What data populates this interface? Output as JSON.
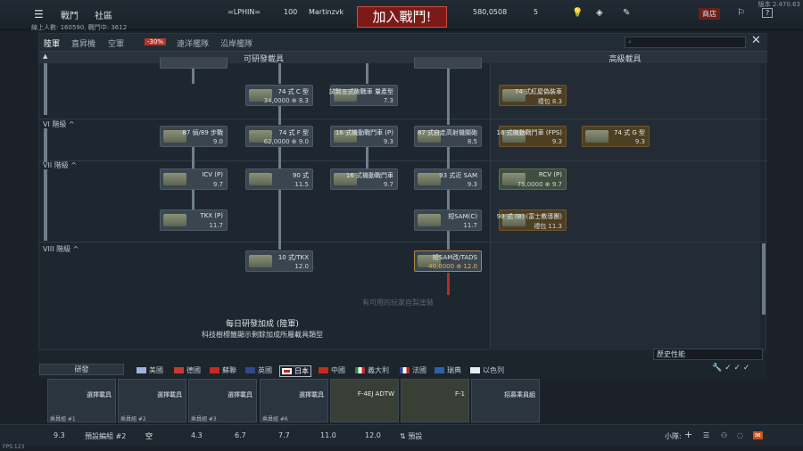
{
  "version": "版本 2.470.63",
  "top": {
    "menu": [
      "戰鬥",
      "社區"
    ],
    "squad_tag": "=LPHIN=",
    "level": "100",
    "nick": "Martinzvk",
    "join": "加入戰鬥!",
    "silver": "580,0508",
    "gold": "5",
    "shop": "商店",
    "help": "?"
  },
  "online": "線上人數: 160590, 戰鬥中: 3612",
  "tabs": [
    {
      "label": "陸軍",
      "active": true
    },
    {
      "label": "直昇機"
    },
    {
      "label": "空軍"
    },
    {
      "label": "-30%"
    },
    {
      "label": "遠洋艦隊"
    },
    {
      "label": "沿岸艦隊"
    }
  ],
  "heads": {
    "research": "可研發載具",
    "premium": "高級載具"
  },
  "ranks": [
    "VI 階級 ^",
    "VII 階級 ^",
    "VIII 階級 ^"
  ],
  "vehicles": [
    {
      "n": "74 式 C 型",
      "b": "34,0000 ⊕ 8.3"
    },
    {
      "n": "試製五式砲戰車 量產型",
      "b": "7.3"
    },
    {
      "n": "87 偵/89 步戰",
      "b": "9.0"
    },
    {
      "n": "74 式 F 型",
      "b": "62,0000 ⊕ 9.0"
    },
    {
      "n": "16 式機動戰鬥車 (P)",
      "b": "9.3"
    },
    {
      "n": "87 式自走高射機關砲",
      "b": "8.5"
    },
    {
      "n": "ICV (P)",
      "b": "9.7"
    },
    {
      "n": "90 式",
      "b": "11.5"
    },
    {
      "n": "16 式機動戰鬥車",
      "b": "9.7"
    },
    {
      "n": "93 式近 SAM",
      "b": "9.3"
    },
    {
      "n": "TKX (P)",
      "b": "11.7"
    },
    {
      "n": "短SAM(C)",
      "b": "11.7"
    },
    {
      "n": "10 式/TKX",
      "b": "12.0"
    },
    {
      "n": "短SAM改/TADS",
      "b": "40,0000 ⊕ 12.0"
    }
  ],
  "premium": [
    {
      "n": "74 式紅屋偽裝車",
      "b": "禮包 8.3"
    },
    {
      "n": "16 式機動戰鬥車 (FPS)",
      "b": "9.3"
    },
    {
      "n": "74 式 G 型",
      "b": "9.3"
    },
    {
      "n": "RCV (P)",
      "b": "75,0000 ⊕ 9.7"
    },
    {
      "n": "90 式 (B) (富士教導團)",
      "b": "禮包 11.3"
    }
  ],
  "bonus": {
    "l1": "每日研發加成 (陸軍)",
    "l2": "科技樹標籤顯示剩餘加成所屬載具類型"
  },
  "ghost": "有可用的玩家自製塗裝",
  "research_btn": "研發",
  "nations": [
    "美國",
    "德國",
    "蘇聯",
    "英國",
    "日本",
    "中國",
    "義大利",
    "法國",
    "瑞典",
    "以色列"
  ],
  "filter": "歷史性能",
  "crew": [
    {
      "lbl": "乘員組 #1",
      "act": "選擇載具"
    },
    {
      "lbl": "乘員組 #2",
      "act": "選擇載具"
    },
    {
      "lbl": "乘員組 #3",
      "act": "選擇載具"
    },
    {
      "lbl": "乘員組 #6",
      "act": "選擇載具"
    },
    {
      "lbl": "",
      "act": "F-4EJ ADTW"
    },
    {
      "lbl": "",
      "act": "F-1"
    },
    {
      "lbl": "",
      "act": "招募乘員組"
    }
  ],
  "bottom": [
    "9.3",
    "預設編組 #2",
    "空",
    "4.3",
    "6.7",
    "7.7",
    "11.0",
    "12.0",
    "預設",
    "小隊:"
  ],
  "fps": "FPS:123"
}
